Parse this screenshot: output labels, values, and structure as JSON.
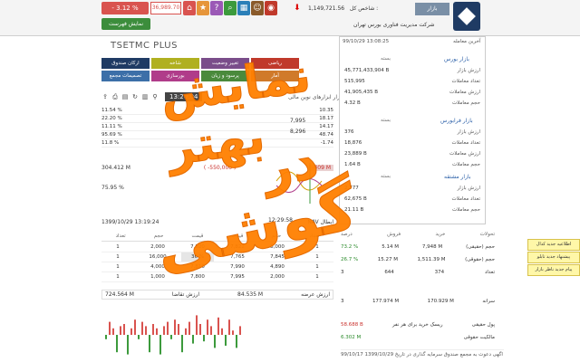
{
  "topbar": {
    "change_pct": "- 3.12 %",
    "value": "36,989.70",
    "watch_label": "نمایش فهرست",
    "index_label": "شاخص کل :",
    "index_value": "1,149,721.56",
    "market_label": "بازار",
    "company_name": "شرکت مدیریت فناوری بورس تهران",
    "icons": [
      "home-icon",
      "star-icon",
      "help-icon",
      "search-icon",
      "grid-icon",
      "user-icon",
      "logo-icon"
    ]
  },
  "brand": "TSETMC PLUS",
  "menu": [
    "ارکان صندوق",
    "شاخه",
    "تغییر وضعیت",
    "ریاضی",
    "تصمیمات مجمع",
    "بورسازی",
    "پرسود و زیان",
    "آمار"
  ],
  "clock": "13:20:04",
  "mid": {
    "title": "بازار ابزارهای نوین مالی",
    "vals": [
      "7,995",
      "8,296"
    ],
    "time": "12:29:58"
  },
  "left_rows": [
    {
      "a": "11.54 %",
      "b": "10.35"
    },
    {
      "a": "22.20 %",
      "b": "18.17"
    },
    {
      "a": "11.11 %",
      "b": "14.17"
    },
    {
      "a": "95.69 %",
      "b": "48.74"
    },
    {
      "a": "11.8 %",
      "b": "-1.74"
    }
  ],
  "summary": {
    "left_val": "304.412 M",
    "neg_val": "( -550,000 )",
    "red_val": "-409 M",
    "pct": "75.95 %",
    "date": "1399/10/29 13:19:24",
    "nav_label": "NAV ابطال"
  },
  "order": {
    "headers": [
      "تعداد",
      "حجم",
      "قیمت",
      "قیمت",
      "حجم",
      "تعداد"
    ],
    "rows": [
      [
        "1",
        "2,000",
        "7,820",
        "7,822",
        "8,000",
        "1"
      ],
      [
        "1",
        "16,000",
        "36 %",
        "7,765",
        "7,845",
        "1"
      ],
      [
        "1",
        "4,000",
        "7,810",
        "7,990",
        "4,890",
        "1"
      ],
      [
        "1",
        "1,000",
        "7,800",
        "7,995",
        "2,000",
        "1"
      ]
    ],
    "total_left": "724.564 M",
    "total_right": "84.535 M",
    "total_label": "ارزش تقاضا",
    "total_label2": "ارزش عرضه"
  },
  "stats": {
    "last_trade_label": "آخرین معامله",
    "date": "99/10/29 13:08:25",
    "sections": [
      {
        "title": "بازار بورس",
        "status": "بسته",
        "rows": [
          {
            "lbl": "ارزش بازار",
            "val": "45,771,433,904 B"
          },
          {
            "lbl": "تعداد معاملات",
            "val": "515,995"
          },
          {
            "lbl": "ارزش معاملات",
            "val": "41,905,435 B"
          },
          {
            "lbl": "حجم معاملات",
            "val": "4.32 B"
          }
        ]
      },
      {
        "title": "بازار فرابورس",
        "status": "بسته",
        "rows": [
          {
            "lbl": "ارزش بازار",
            "val": "376"
          },
          {
            "lbl": "تعداد معاملات",
            "val": "18,876"
          },
          {
            "lbl": "ارزش معاملات",
            "val": "23,889 B"
          },
          {
            "lbl": "حجم معاملات",
            "val": "1.64 B"
          }
        ]
      },
      {
        "title": "بازار مشتقه",
        "status": "بسته",
        "rows": [
          {
            "lbl": "ارزش بازار",
            "val": "2,777"
          },
          {
            "lbl": "تعداد معاملات",
            "val": "62,675 B"
          },
          {
            "lbl": "حجم معاملات",
            "val": "21.11 B"
          }
        ]
      }
    ]
  },
  "lower": {
    "headers": [
      "تحولات",
      "خرید",
      "فروش",
      "درصد"
    ],
    "rows": [
      {
        "lbl": "حجم (حقیقی)",
        "a": "7,948 M",
        "b": "5.14 M",
        "c": "73.2 %"
      },
      {
        "lbl": "حجم (حقوقی)",
        "a": "1,511.39 M",
        "b": "15.27 M",
        "c": "26.7 %"
      },
      {
        "lbl": "تعداد",
        "a": "374",
        "b": "644",
        "c": "3"
      },
      {
        "lbl": "سرانه",
        "a": "170.929 M",
        "b": "177.974 M",
        "c": "3"
      }
    ],
    "power_label": "پول حقیقی",
    "power_val": "58.688 B",
    "power_note": "ریسک خرید برای هر نفر",
    "ratio_label": "مالکیت حقوقی",
    "ratio_val": "6.302 M"
  },
  "ticker": "99/10/17  اگهی دعوت به مجمع صندوق سرمایه گذاری در تاریخ 1399/10/29",
  "side_panel": [
    "اطلاعیه جدید کدال",
    "پیشنهاد جدید تابلو",
    "پیام جدید ناظر بازار"
  ],
  "overlay": {
    "line1": "نمایش بهتر",
    "line2": "در",
    "line3": "گوشی"
  }
}
